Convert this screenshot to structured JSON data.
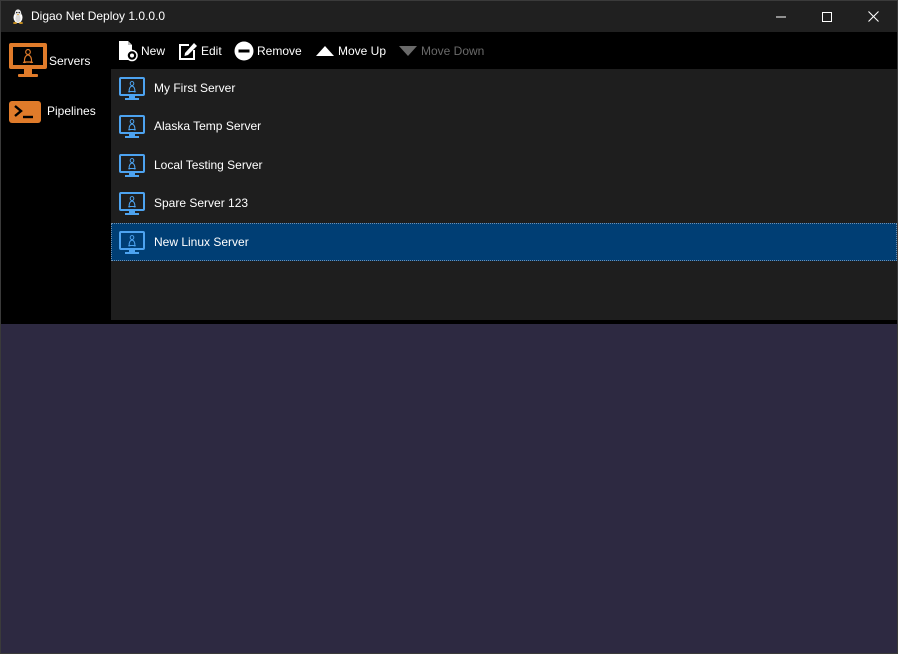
{
  "window": {
    "title": "Digao Net Deploy 1.0.0.0",
    "icon": "linux-tux-icon"
  },
  "sidebar": {
    "items": [
      {
        "label": "Servers",
        "icon": "server-monitor-icon",
        "accent": "#e07b2a"
      },
      {
        "label": "Pipelines",
        "icon": "terminal-prompt-icon",
        "accent": "#e07b2a"
      }
    ]
  },
  "toolbar": {
    "new_label": "New",
    "edit_label": "Edit",
    "remove_label": "Remove",
    "move_up_label": "Move Up",
    "move_down_label": "Move Down"
  },
  "servers": [
    {
      "name": "My First Server"
    },
    {
      "name": "Alaska Temp Server"
    },
    {
      "name": "Local Testing Server"
    },
    {
      "name": "Spare Server 123"
    },
    {
      "name": "New Linux Server",
      "selected": true
    }
  ],
  "colors": {
    "accent_orange": "#e07b2a",
    "selection": "#003e74",
    "server_icon_blue": "#4da3f0",
    "background_bottom": "#2d2941"
  }
}
